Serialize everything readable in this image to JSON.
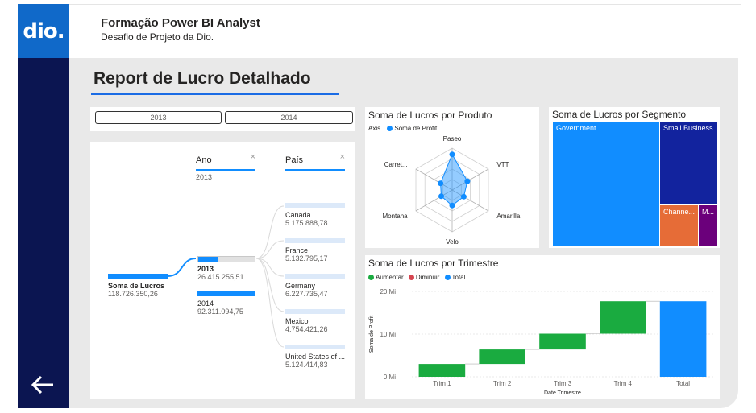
{
  "app": {
    "logo": "dio.",
    "title": "Formação Power BI Analyst",
    "subtitle": "Desafio de Projeto da Dio."
  },
  "report": {
    "title": "Report de Lucro Detalhado"
  },
  "nav": {
    "back_icon": "arrow-left-icon"
  },
  "slicer": {
    "options": [
      "2013",
      "2014"
    ]
  },
  "decomp": {
    "level1": {
      "header": "Ano",
      "selected": "2013",
      "close_icon": "×"
    },
    "level2": {
      "header": "País",
      "close_icon": "×"
    },
    "root": {
      "label": "Soma de Lucros",
      "value": "118.726.350,26"
    },
    "years": [
      {
        "label": "2013",
        "value": "26.415.255,51",
        "fill": 0.22
      },
      {
        "label": "2014",
        "value": "92.311.094,75",
        "fill": 0.78
      }
    ],
    "countries": [
      {
        "label": "Canada",
        "value": "5.175.888,78"
      },
      {
        "label": "France",
        "value": "5.132.795,17"
      },
      {
        "label": "Germany",
        "value": "6.227.735,47"
      },
      {
        "label": "Mexico",
        "value": "4.754.421,26"
      },
      {
        "label": "United States of ...",
        "value": "5.124.414,83"
      }
    ]
  },
  "radar": {
    "title": "Soma de Lucros por Produto",
    "legend_axis": "Axis",
    "legend_series": "Soma de Profit",
    "color": "#118dff"
  },
  "treemap": {
    "title": "Soma de Lucros por Segmento",
    "cells": [
      {
        "label": "Government",
        "color": "#118dff"
      },
      {
        "label": "Small Business",
        "color": "#12239e"
      },
      {
        "label": "Channe...",
        "color": "#e66c37"
      },
      {
        "label": "M...",
        "color": "#6b007b"
      }
    ]
  },
  "chart_data": [
    {
      "type": "radar",
      "title": "Soma de Lucros por Produto",
      "categories": [
        "Paseo",
        "VTT",
        "Amarilla",
        "Velo",
        "Montana",
        "Carret..."
      ],
      "series": [
        {
          "name": "Soma de Profit",
          "values": [
            0.85,
            0.42,
            0.32,
            0.37,
            0.3,
            0.32
          ]
        }
      ]
    },
    {
      "type": "waterfall",
      "title": "Soma de Lucros por Trimestre",
      "categories": [
        "Trim 1",
        "Trim 2",
        "Trim 3",
        "Trim 4",
        "Total"
      ],
      "values": [
        3.0,
        3.4,
        3.7,
        7.6,
        17.7
      ],
      "kinds": [
        "increase",
        "increase",
        "increase",
        "increase",
        "total"
      ],
      "legend": [
        {
          "label": "Aumentar",
          "color": "#1aab40"
        },
        {
          "label": "Diminuir",
          "color": "#d64550"
        },
        {
          "label": "Total",
          "color": "#118dff"
        }
      ],
      "yticks": [
        "0 Mi",
        "10 Mi",
        "20 Mi"
      ],
      "ylim": [
        0,
        20
      ],
      "xlabel": "Date Trimestre",
      "ylabel": "Soma de Profit"
    }
  ]
}
